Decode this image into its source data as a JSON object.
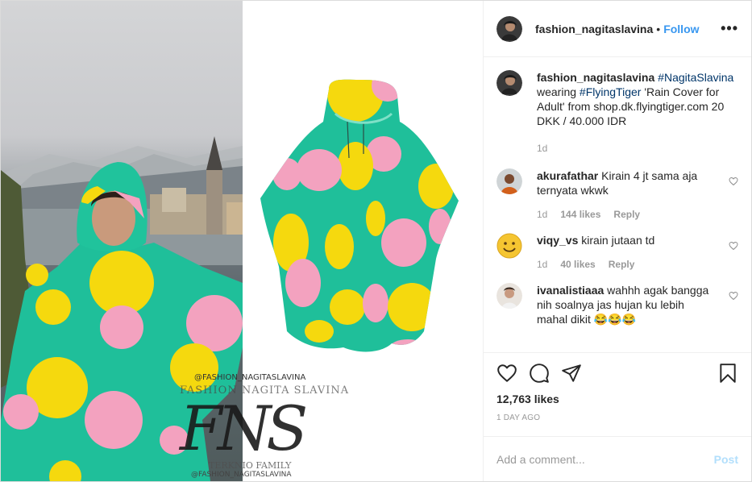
{
  "post": {
    "username": "fashion_nagitaslavina",
    "separator": "•",
    "follow_label": "Follow",
    "more_icon": "more-options-icon",
    "more_label": "•••"
  },
  "image": {
    "watermark_handle": "@FASHION_NAGITASLAVINA",
    "watermark_name": "FASHION NAGITA SLAVINA",
    "watermark_logo": "FNS",
    "watermark_family": "TERKNIO FAMILY",
    "watermark_handle2": "@FASHION_NAGITASLAVINA"
  },
  "caption": {
    "username": "fashion_nagitaslavina",
    "tag1": "#NagitaSlavina",
    "text1": "wearing",
    "tag2": "#FlyingTiger",
    "text2": "'Rain Cover for Adult' from shop.dk.flyingtiger.com 20 DKK / 40.000 IDR",
    "time": "1d"
  },
  "comments": [
    {
      "username": "akurafathar",
      "text": "Kirain 4 jt sama aja ternyata wkwk",
      "time": "1d",
      "likes": "144 likes",
      "reply": "Reply"
    },
    {
      "username": "viqy_vs",
      "text": "kirain jutaan td",
      "time": "1d",
      "likes": "40 likes",
      "reply": "Reply"
    },
    {
      "username": "ivanalistiaaa",
      "text": "wahhh agak bangga nih soalnya jas hujan ku lebih mahal dikit 😂😂😂"
    }
  ],
  "actions": {
    "like_icon": "heart-icon",
    "comment_icon": "comment-icon",
    "share_icon": "share-icon",
    "save_icon": "bookmark-icon"
  },
  "likes_count": "12,763 likes",
  "date": "1 DAY AGO",
  "add_comment": {
    "placeholder": "Add a comment...",
    "post_label": "Post"
  },
  "colors": {
    "accent": "#3897f0",
    "hashtag": "#003569",
    "post_disabled": "#b2dffc",
    "poncho_green": "#1fbf9a",
    "poncho_yellow": "#f5d90e",
    "poncho_pink": "#f3a2bf"
  }
}
